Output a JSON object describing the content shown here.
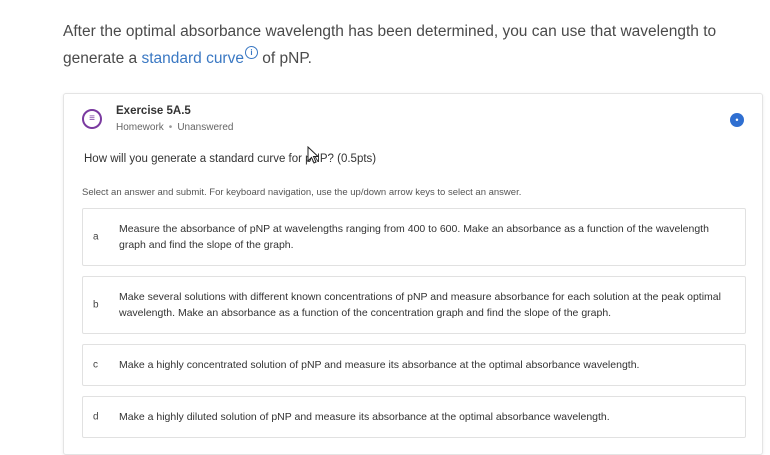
{
  "intro": {
    "text_before": "After the optimal absorbance wavelength has been determined, you can use that wavelength to generate a ",
    "link_text": "standard curve",
    "info_icon": "ⓘ",
    "text_after": " of pNP."
  },
  "exercise": {
    "icon": "≡",
    "title": "Exercise 5A.5",
    "type": "Homework",
    "status": "Unanswered",
    "menu_icon": "•"
  },
  "question": "How will you generate a standard curve for pNP? (0.5pts)",
  "instructions": "Select an answer and submit. For keyboard navigation, use the up/down arrow keys to select an answer.",
  "options": [
    {
      "letter": "a",
      "text": "Measure the absorbance of pNP at wavelengths ranging from 400 to 600. Make an absorbance as a function of the wavelength graph and find the slope of the graph."
    },
    {
      "letter": "b",
      "text": "Make several solutions with different known concentrations of pNP and measure absorbance for each solution at the peak optimal wavelength. Make an absorbance as a function of the concentration graph and find the slope of the graph."
    },
    {
      "letter": "c",
      "text": "Make a highly concentrated solution of pNP and measure its absorbance at the optimal absorbance wavelength."
    },
    {
      "letter": "d",
      "text": "Make a highly diluted solution of pNP and measure its absorbance at the optimal absorbance wavelength."
    }
  ]
}
